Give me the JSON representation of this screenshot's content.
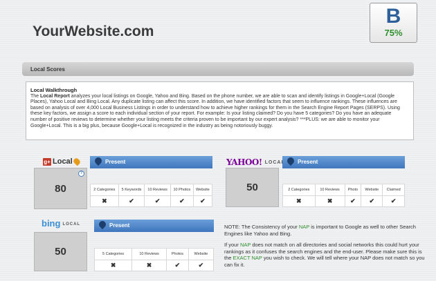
{
  "site": {
    "title": "YourWebsite.com"
  },
  "grade": {
    "letter": "B",
    "percent": "75%"
  },
  "section": {
    "title": "Local Scores"
  },
  "walkthrough": {
    "title": "Local Walkthrough",
    "intro": "The ",
    "bold": "Local Report",
    "body": " analyzes your local listings on Google, Yahoo and Bing. Based on the phone number, we are able to scan and identify listings in Google+Local (Google Places), Yahoo Local and Bing Local. Any duplicate listing can affect this score. In addition, we have identified factors that seem to influence rankings. These influences are based on analysis of over 4,000 Local Business Listings in order to understand how to achieve higher rankings for them in the Search Engine Report Pages (SERPS). Using these key factors, we assign a score to each individual section of your report. For example: Is your listing claimed? Do you have 5 categories? Do you have an adequate number of positive reviews to determine whether your listing meets the criteria proven to be important by our expert analysis? ***PLUS: we are able to monitor your Google+Local. This is a big plus, because Google+Local is recognized in the industry as being notoriously buggy."
  },
  "listings": {
    "google": {
      "logo_text": "Local",
      "logo_badge": "g+",
      "score": "80",
      "status": "Present",
      "help": "?",
      "factors": [
        "2 Categories",
        "5 Keywords",
        "10 Reviews",
        "10 Photos",
        "Website"
      ],
      "marks": [
        "x",
        "ok",
        "ok",
        "ok",
        "ok"
      ]
    },
    "yahoo": {
      "logo_text": "YAHOO!",
      "logo_sub": "LOCAL",
      "score": "50",
      "status": "Present",
      "factors": [
        "2 Categories",
        "10 Reviews",
        "Photo",
        "Website",
        "Claimed"
      ],
      "marks": [
        "x",
        "x",
        "ok",
        "ok",
        "ok"
      ]
    },
    "bing": {
      "logo_text": "bing",
      "logo_sub": "LOCAL",
      "score": "50",
      "status": "Present",
      "factors": [
        "5 Categories",
        "10 Reviews",
        "Photos",
        "Website"
      ],
      "marks": [
        "x",
        "x",
        "ok",
        "ok"
      ]
    }
  },
  "note": {
    "p1_a": "NOTE: The Consistency of your ",
    "p1_link": "NAP",
    "p1_b": " is important to Google as well to other Search Engines like Yahoo and Bing.",
    "p2_a": "If your ",
    "p2_link1": "NAP",
    "p2_b": " does not match on all directories and social networks this could hurt your rankings as it confuses the search engines and the end-user. Please make sure this is the ",
    "p2_link2": "EXACT NAP",
    "p2_c": " you wish to check. We will tell where your NAP does not match so you can fix it."
  },
  "colors": {
    "present_bar": "#4a80c4",
    "grade_letter": "#2d5f9a",
    "grade_percent": "#2e8f2e",
    "mark_x": "#d12a2a",
    "mark_ok": "#3a9a2a"
  }
}
